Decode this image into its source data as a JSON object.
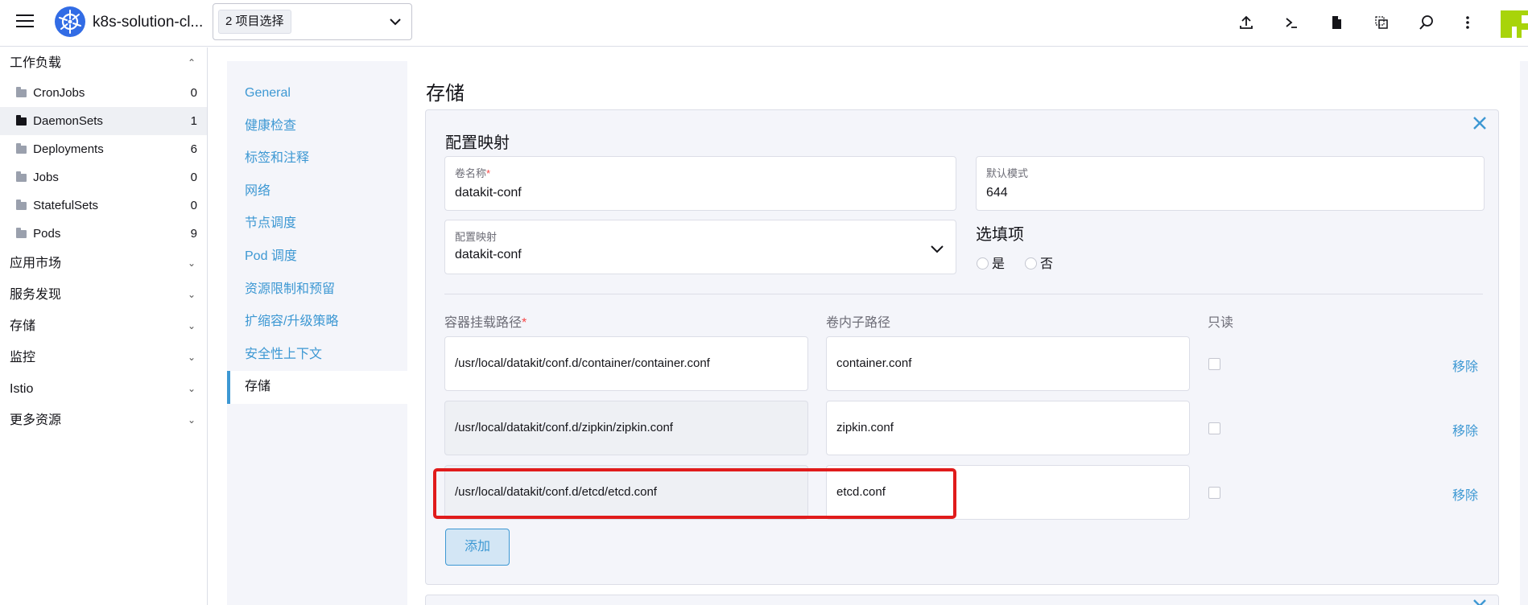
{
  "header": {
    "cluster_name": "k8s-solution-cl...",
    "namespace_chip": "2 项目选择",
    "icons": [
      "import-yaml-icon",
      "kubectl-shell-icon",
      "kubeconfig-file-icon",
      "copy-kubeconfig-icon",
      "search-icon",
      "more-vertical-icon"
    ]
  },
  "leftnav": {
    "workloads": {
      "label": "工作负载",
      "items": [
        {
          "label": "CronJobs",
          "count": "0"
        },
        {
          "label": "DaemonSets",
          "count": "1"
        },
        {
          "label": "Deployments",
          "count": "6"
        },
        {
          "label": "Jobs",
          "count": "0"
        },
        {
          "label": "StatefulSets",
          "count": "0"
        },
        {
          "label": "Pods",
          "count": "9"
        }
      ]
    },
    "groups": [
      "应用市场",
      "服务发现",
      "存储",
      "监控",
      "Istio",
      "更多资源"
    ]
  },
  "tabs": [
    "General",
    "健康检查",
    "标签和注释",
    "网络",
    "节点调度",
    "Pod 调度",
    "资源限制和预留",
    "扩缩容/升级策略",
    "安全性上下文",
    "存储"
  ],
  "main": {
    "title": "存储",
    "card": {
      "title": "配置映射",
      "volume_name": {
        "label": "卷名称",
        "required": "*",
        "value": "datakit-conf"
      },
      "default_mode": {
        "label": "默认模式",
        "value": "644"
      },
      "config_map": {
        "label": "配置映射",
        "value": "datakit-conf"
      },
      "options": {
        "title": "选填项",
        "yes": "是",
        "no": "否"
      },
      "columns": {
        "mount_path": "容器挂载路径",
        "required": "*",
        "sub_path": "卷内子路径",
        "read_only": "只读"
      },
      "mounts": [
        {
          "path": "/usr/local/datakit/conf.d/container/container.conf",
          "sub_path": "container.conf",
          "remove": "移除"
        },
        {
          "path": "/usr/local/datakit/conf.d/zipkin/zipkin.conf",
          "sub_path": "zipkin.conf",
          "remove": "移除"
        },
        {
          "path": "/usr/local/datakit/conf.d/etcd/etcd.conf",
          "sub_path": "etcd.conf",
          "remove": "移除"
        }
      ],
      "add_label": "添加"
    }
  },
  "colors": {
    "accent": "#3d98d3",
    "highlight": "#e01b1b",
    "k8s_blue": "#326ce5",
    "panel": "#f4f5fa"
  }
}
